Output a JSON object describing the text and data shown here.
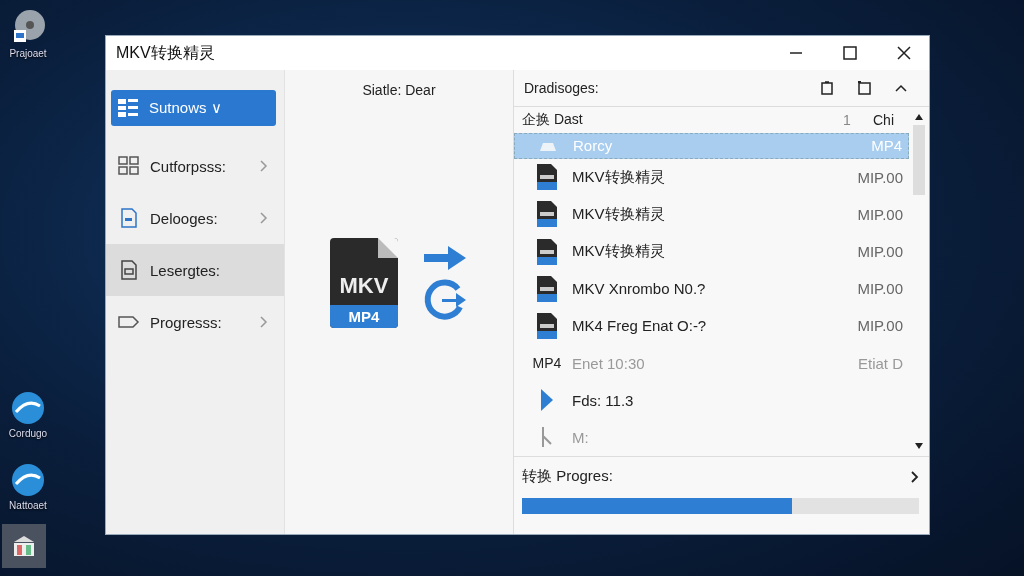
{
  "desktop": {
    "icons": [
      {
        "label": "Prajoaet"
      },
      {
        "label": "Cordugo"
      },
      {
        "label": "Nattoaet"
      }
    ]
  },
  "window": {
    "title": "MKV转换精灵"
  },
  "sidebar": {
    "items": [
      {
        "label": "Sutnows ∨",
        "selected": true,
        "highlighted": false,
        "chevron": false
      },
      {
        "label": "Cutforpsss:",
        "selected": false,
        "highlighted": false,
        "chevron": true
      },
      {
        "label": "Delooges:",
        "selected": false,
        "highlighted": false,
        "chevron": true
      },
      {
        "label": "Lesergtes:",
        "selected": false,
        "highlighted": true,
        "chevron": false
      },
      {
        "label": "Progresss:",
        "selected": false,
        "highlighted": false,
        "chevron": true
      }
    ]
  },
  "center": {
    "status": "Siatle: Dear",
    "file_icon_top": "MKV",
    "file_icon_bottom": "MP4"
  },
  "panel": {
    "title": "Dradisoges:",
    "list_header": {
      "column_1": "企换 Dast",
      "column_2": "1",
      "column_3": "Chi"
    },
    "rows": [
      {
        "kind": "blank",
        "name": "Rorcy",
        "value": "MP4",
        "selected": true,
        "muted": false
      },
      {
        "kind": "file",
        "name": "MKV转换精灵",
        "value": "MIP.00",
        "selected": false,
        "muted": false
      },
      {
        "kind": "file",
        "name": "MKV转换精灵",
        "value": "MIP.00",
        "selected": false,
        "muted": false
      },
      {
        "kind": "file",
        "name": "MKV转换精灵",
        "value": "MIP.00",
        "selected": false,
        "muted": false
      },
      {
        "kind": "file",
        "name": "MKV Xnrombo N0.?",
        "value": "MIP.00",
        "selected": false,
        "muted": false
      },
      {
        "kind": "file",
        "name": "MK4 Freg Enat O:-?",
        "value": "MIP.00",
        "selected": false,
        "muted": false
      },
      {
        "kind": "label",
        "tag": "MP4",
        "name": "Enet 10:30",
        "value": "Etiat D",
        "selected": false,
        "muted": true
      },
      {
        "kind": "play",
        "name": "Fds: 11.3",
        "selected": false,
        "muted": false
      },
      {
        "kind": "pin",
        "name": "M:",
        "selected": false,
        "muted": true
      }
    ]
  },
  "progress": {
    "label": "转换 Progres:",
    "level": 0.68
  }
}
